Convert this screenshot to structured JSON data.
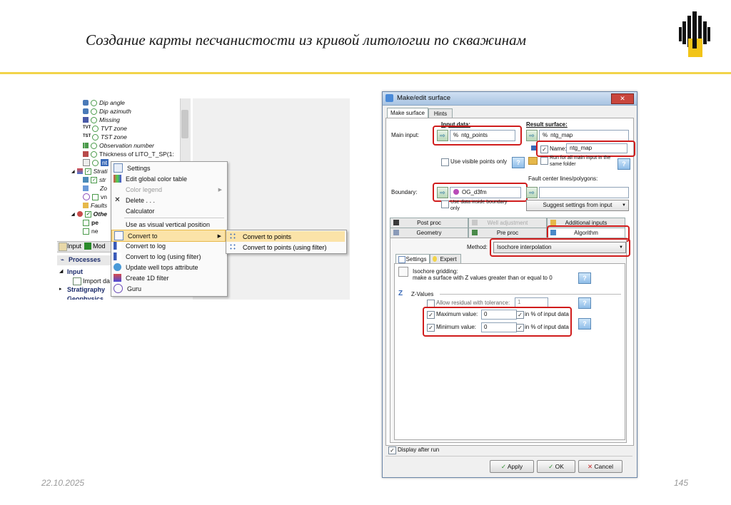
{
  "slide": {
    "title": "Создание карты песчанистости из кривой литологии по скважинам",
    "date": "22.10.2025",
    "page": "145"
  },
  "tree": {
    "items": [
      {
        "label": "Dip angle"
      },
      {
        "label": "Dip azimuth"
      },
      {
        "label": "Missing"
      },
      {
        "label": "TVT zone"
      },
      {
        "label": "TST zone"
      },
      {
        "label": "Observation number"
      },
      {
        "label": "Thickness of LITO_T_SP(1:"
      },
      {
        "label": "nt"
      },
      {
        "label": "Strati"
      },
      {
        "label": "str"
      },
      {
        "label": "Zo"
      },
      {
        "label": "vn"
      },
      {
        "label": "Faults"
      },
      {
        "label": "Othe"
      },
      {
        "label": "pe"
      },
      {
        "label": "ne"
      }
    ],
    "icon_labels": {
      "tvt": "TVT",
      "tst": "TST"
    },
    "bottom_tabs": {
      "input": "Input",
      "models": "Mod"
    },
    "processes_label": "Processes",
    "input_label": "Input",
    "import_label": "Import da",
    "stratigraphy_label": "Stratigraphy",
    "geophysics_label": "Geophysics"
  },
  "context_menu": {
    "items": [
      {
        "label": "Settings"
      },
      {
        "label": "Edit global color table"
      },
      {
        "label": "Color legend"
      },
      {
        "label": "Delete . . ."
      },
      {
        "label": "Calculator"
      },
      {
        "label": "Use as visual vertical position"
      },
      {
        "label": "Convert to"
      },
      {
        "label": "Convert to log"
      },
      {
        "label": "Convert to log (using filter)"
      },
      {
        "label": "Update well tops attribute"
      },
      {
        "label": "Create 1D filter"
      },
      {
        "label": "Guru"
      }
    ],
    "submenu": [
      {
        "label": "Convert to points"
      },
      {
        "label": "Convert to points (using filter)"
      }
    ]
  },
  "dialog": {
    "title": "Make/edit surface",
    "close": "✕",
    "tabs": [
      "Make surface",
      "Hints"
    ],
    "input_data_label": "Input data:",
    "result_surface_label": "Result surface:",
    "main_input_label": "Main input:",
    "main_input_value": "ntg_points",
    "result_value": "ntg_map",
    "name_label": "Name:",
    "name_value": "ntg_map",
    "run_all_label": "Run for all main input in the same folder",
    "use_visible_label": "Use visible points only",
    "fault_label": "Fault center lines/polygons:",
    "boundary_label": "Boundary:",
    "boundary_value": "OG_d3fm",
    "use_data_inside_label": "Use data inside boundary only",
    "suggest_label": "Suggest settings from input",
    "algo_tabs": [
      "Post proc",
      "Well adjustment",
      "Additional inputs",
      "Geometry",
      "Pre proc",
      "Algorithm"
    ],
    "method_label": "Method:",
    "method_value": "Isochore interpolation",
    "sub_tabs": [
      "Settings",
      "Expert"
    ],
    "isochore_title": "Isochore gridding:",
    "isochore_desc": "make a surface with Z values greater than or equal to 0",
    "zvalues_label": "Z-Values",
    "residual_label": "Allow residual with tolerance:",
    "residual_value": "1",
    "max_label": "Maximum value:",
    "max_value": "0",
    "min_label": "Minimum value:",
    "min_value": "0",
    "pct_label": "in % of input data",
    "display_after_run": "Display after run",
    "apply": "Apply",
    "ok": "OK",
    "cancel": "Cancel",
    "check_mark": "✓"
  }
}
